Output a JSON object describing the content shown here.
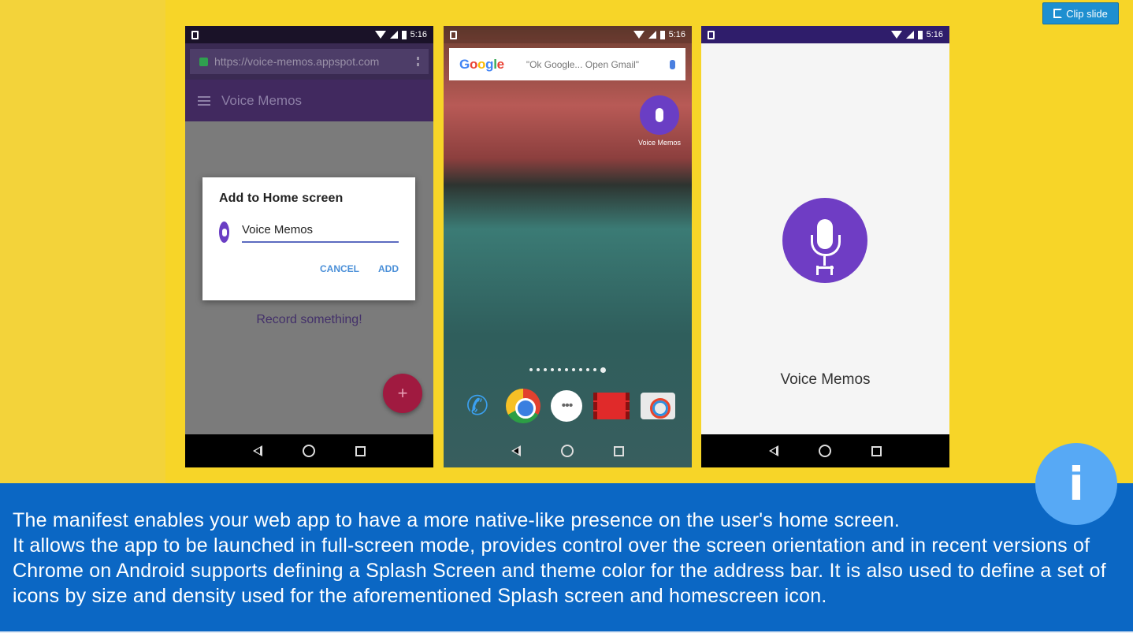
{
  "toolbar": {
    "clip_label": "Clip slide"
  },
  "status": {
    "time": "5:16"
  },
  "phone1": {
    "url": "https://voice-memos.appspot.com",
    "app_title": "Voice Memos",
    "dialog_title": "Add to Home screen",
    "dialog_input_value": "Voice Memos",
    "cancel_label": "CANCEL",
    "add_label": "ADD",
    "record_text": "Record something!",
    "fab_symbol": "+"
  },
  "phone2": {
    "search_logo": "Google",
    "search_hint": "\"Ok Google... Open Gmail\"",
    "shortcut_label": "Voice Memos",
    "apps_icon": "•••"
  },
  "phone3": {
    "splash_title": "Voice Memos"
  },
  "info": {
    "badge": "i",
    "text": "The manifest enables your web app to have a more native-like presence on the user's home screen.\n It allows the app to be launched in full-screen mode, provides control over the screen orientation and in recent versions of Chrome on Android supports defining a Splash Screen and theme color for the address bar. It is also used to define a set of icons by size and density used for the aforementioned Splash screen and homescreen icon."
  },
  "colors": {
    "slide_background": "#f7d528",
    "info_band": "#0b67c4",
    "brand_purple": "#6f3dc4",
    "clip_button": "#1e8fd0"
  }
}
